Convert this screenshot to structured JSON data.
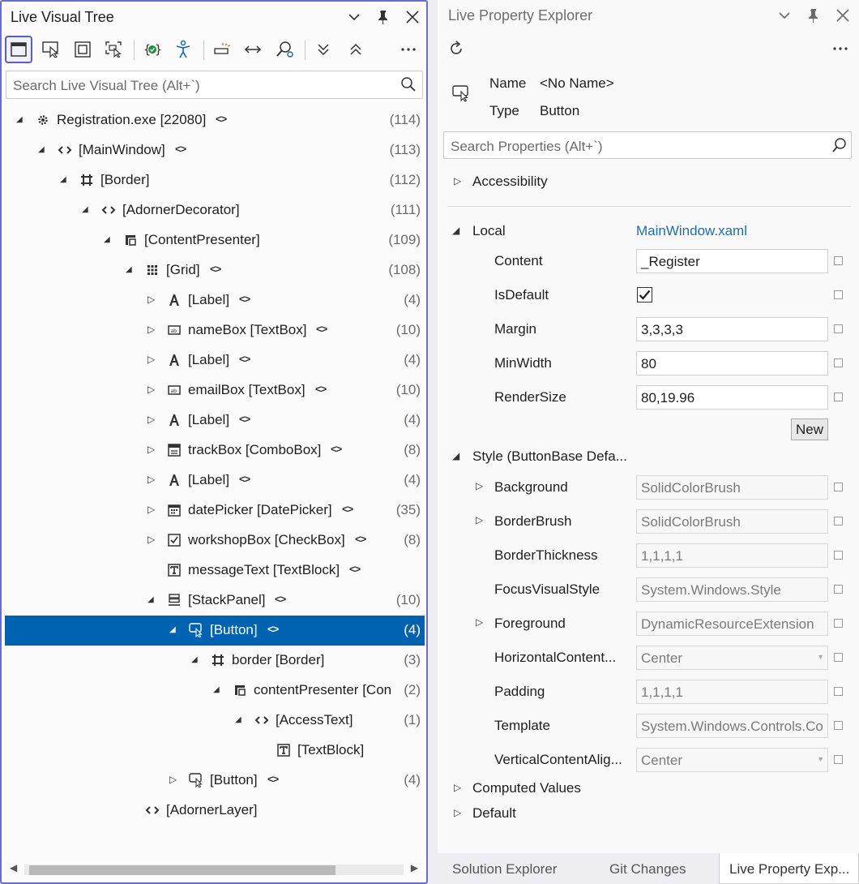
{
  "left_pane": {
    "title": "Live Visual Tree",
    "search_placeholder": "Search Live Visual Tree (Alt+`)",
    "tree": [
      {
        "label": "Registration.exe [22080]",
        "count": "(114)",
        "icon": "process-icon",
        "expander": "expanded",
        "xaml": "<>"
      },
      {
        "label": "[MainWindow]",
        "count": "(113)",
        "icon": "code-icon",
        "expander": "expanded",
        "xaml": "<>"
      },
      {
        "label": "[Border]",
        "count": "(112)",
        "icon": "border-icon",
        "expander": "expanded",
        "xaml": ""
      },
      {
        "label": "[AdornerDecorator]",
        "count": "(111)",
        "icon": "code-icon",
        "expander": "expanded",
        "xaml": ""
      },
      {
        "label": "[ContentPresenter]",
        "count": "(109)",
        "icon": "content-presenter-icon",
        "expander": "expanded",
        "xaml": ""
      },
      {
        "label": "[Grid]",
        "count": "(108)",
        "icon": "grid-icon",
        "expander": "expanded",
        "xaml": "<>"
      },
      {
        "label": "[Label]",
        "count": "(4)",
        "icon": "label-icon",
        "expander": "collapsed",
        "xaml": "<>"
      },
      {
        "label": "nameBox [TextBox]",
        "count": "(10)",
        "icon": "textbox-icon",
        "expander": "collapsed",
        "xaml": "<>"
      },
      {
        "label": "[Label]",
        "count": "(4)",
        "icon": "label-icon",
        "expander": "collapsed",
        "xaml": "<>"
      },
      {
        "label": "emailBox [TextBox]",
        "count": "(10)",
        "icon": "textbox-icon",
        "expander": "collapsed",
        "xaml": "<>"
      },
      {
        "label": "[Label]",
        "count": "(4)",
        "icon": "label-icon",
        "expander": "collapsed",
        "xaml": "<>"
      },
      {
        "label": "trackBox [ComboBox]",
        "count": "(8)",
        "icon": "combobox-icon",
        "expander": "collapsed",
        "xaml": "<>"
      },
      {
        "label": "[Label]",
        "count": "(4)",
        "icon": "label-icon",
        "expander": "collapsed",
        "xaml": "<>"
      },
      {
        "label": "datePicker [DatePicker]",
        "count": "(35)",
        "icon": "datepicker-icon",
        "expander": "collapsed",
        "xaml": "<>"
      },
      {
        "label": "workshopBox [CheckBox]",
        "count": "(8)",
        "icon": "checkbox-icon",
        "expander": "collapsed",
        "xaml": "<>"
      },
      {
        "label": "messageText [TextBlock]",
        "count": "",
        "icon": "textblock-icon",
        "expander": "none",
        "xaml": "<>"
      },
      {
        "label": "[StackPanel]",
        "count": "(10)",
        "icon": "stackpanel-icon",
        "expander": "expanded",
        "xaml": "<>"
      },
      {
        "label": "[Button]",
        "count": "(4)",
        "icon": "button-icon",
        "expander": "expanded",
        "xaml": "<>",
        "selected": true
      },
      {
        "label": "border [Border]",
        "count": "(3)",
        "icon": "border-icon",
        "expander": "expanded",
        "xaml": ""
      },
      {
        "label": "contentPresenter [Con",
        "count": "(2)",
        "icon": "content-presenter-icon",
        "expander": "expanded",
        "xaml": ""
      },
      {
        "label": "[AccessText]",
        "count": "(1)",
        "icon": "code-icon",
        "expander": "expanded",
        "xaml": ""
      },
      {
        "label": "[TextBlock]",
        "count": "",
        "icon": "textblock-icon",
        "expander": "none",
        "xaml": ""
      },
      {
        "label": "[Button]",
        "count": "(4)",
        "icon": "button-icon",
        "expander": "collapsed",
        "xaml": "<>"
      },
      {
        "label": "[AdornerLayer]",
        "count": "",
        "icon": "code-icon",
        "expander": "none",
        "xaml": ""
      }
    ]
  },
  "right_pane": {
    "title": "Live Property Explorer",
    "name_label": "Name",
    "name_value": "<No Name>",
    "type_label": "Type",
    "type_value": "Button",
    "search_placeholder": "Search Properties (Alt+`)",
    "accessibility_label": "Accessibility",
    "local_label": "Local",
    "local_source": "MainWindow.xaml",
    "local_props": [
      {
        "name": "Content",
        "value": "_Register",
        "kind": "text"
      },
      {
        "name": "IsDefault",
        "value": "",
        "kind": "checkbox",
        "checked": true
      },
      {
        "name": "Margin",
        "value": "3,3,3,3",
        "kind": "text"
      },
      {
        "name": "MinWidth",
        "value": "80",
        "kind": "text"
      },
      {
        "name": "RenderSize",
        "value": "80,19.96",
        "kind": "text"
      }
    ],
    "new_button": "New",
    "style_label": "Style (ButtonBase Defa...",
    "style_props": [
      {
        "name": "Background",
        "value": "SolidColorBrush",
        "expander": true
      },
      {
        "name": "BorderBrush",
        "value": "SolidColorBrush",
        "expander": true
      },
      {
        "name": "BorderThickness",
        "value": "1,1,1,1",
        "expander": false
      },
      {
        "name": "FocusVisualStyle",
        "value": "System.Windows.Style",
        "expander": false
      },
      {
        "name": "Foreground",
        "value": "DynamicResourceExtension",
        "expander": true
      },
      {
        "name": "HorizontalContent...",
        "value": "Center",
        "expander": false,
        "dropdown": true
      },
      {
        "name": "Padding",
        "value": "1,1,1,1",
        "expander": false
      },
      {
        "name": "Template",
        "value": "System.Windows.Controls.Co",
        "expander": false
      },
      {
        "name": "VerticalContentAlig...",
        "value": "Center",
        "expander": false,
        "dropdown": true
      }
    ],
    "computed_label": "Computed Values",
    "default_label": "Default"
  },
  "bottom_tabs": [
    "Solution Explorer",
    "Git Changes",
    "Live Property Exp..."
  ],
  "colors": {
    "selection": "#0063b1",
    "accent_border": "#6b6bd6",
    "link": "#1a6fb3"
  }
}
